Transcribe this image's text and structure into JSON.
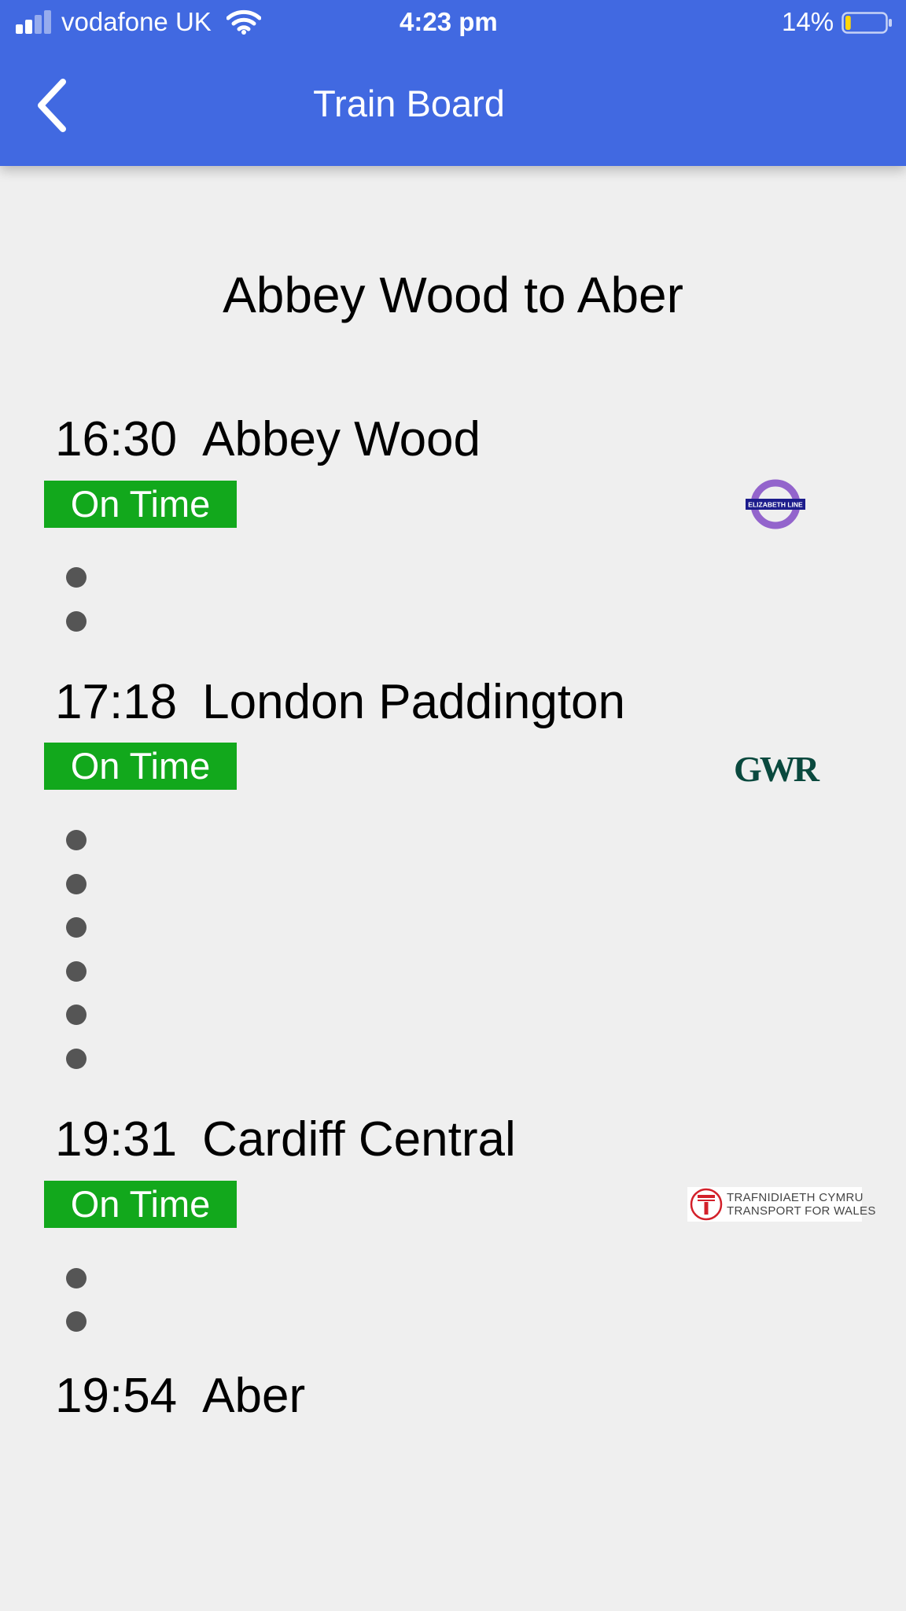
{
  "status_bar": {
    "carrier": "vodafone UK",
    "time": "4:23 pm",
    "battery_percent": "14%",
    "battery_level": 0.14,
    "signal_bars": 2,
    "signal_bars_total": 4,
    "icons": [
      "signal-icon",
      "wifi-icon",
      "battery-icon"
    ]
  },
  "header": {
    "title": "Train Board",
    "back_icon": "chevron-left-icon",
    "background_color": "#4169e1"
  },
  "route": {
    "title": "Abbey Wood to Aber"
  },
  "journey": {
    "stops": [
      {
        "time": "16:30",
        "name": "Abbey Wood"
      },
      {
        "time": "17:18",
        "name": "London Paddington"
      },
      {
        "time": "19:31",
        "name": "Cardiff Central"
      },
      {
        "time": "19:54",
        "name": "Aber"
      }
    ],
    "legs": [
      {
        "status": "On Time",
        "operator_logo": "elizabeth-line-logo",
        "logo_text": "ELIZABETH LINE",
        "intermediate_stops": 2
      },
      {
        "status": "On Time",
        "operator_logo": "gwr-logo",
        "logo_text": "GWR",
        "intermediate_stops": 6
      },
      {
        "status": "On Time",
        "operator_logo": "transport-for-wales-logo",
        "logo_text": [
          "TRAFNIDIAETH CYMRU",
          "TRANSPORT FOR WALES"
        ],
        "intermediate_stops": 2
      }
    ]
  },
  "colors": {
    "on_time": "#12a81c",
    "elizabeth_line_ring": "#9364cc",
    "elizabeth_line_bar": "#1c1c8c",
    "gwr": "#0a493e",
    "tfw_red": "#d3202a"
  }
}
